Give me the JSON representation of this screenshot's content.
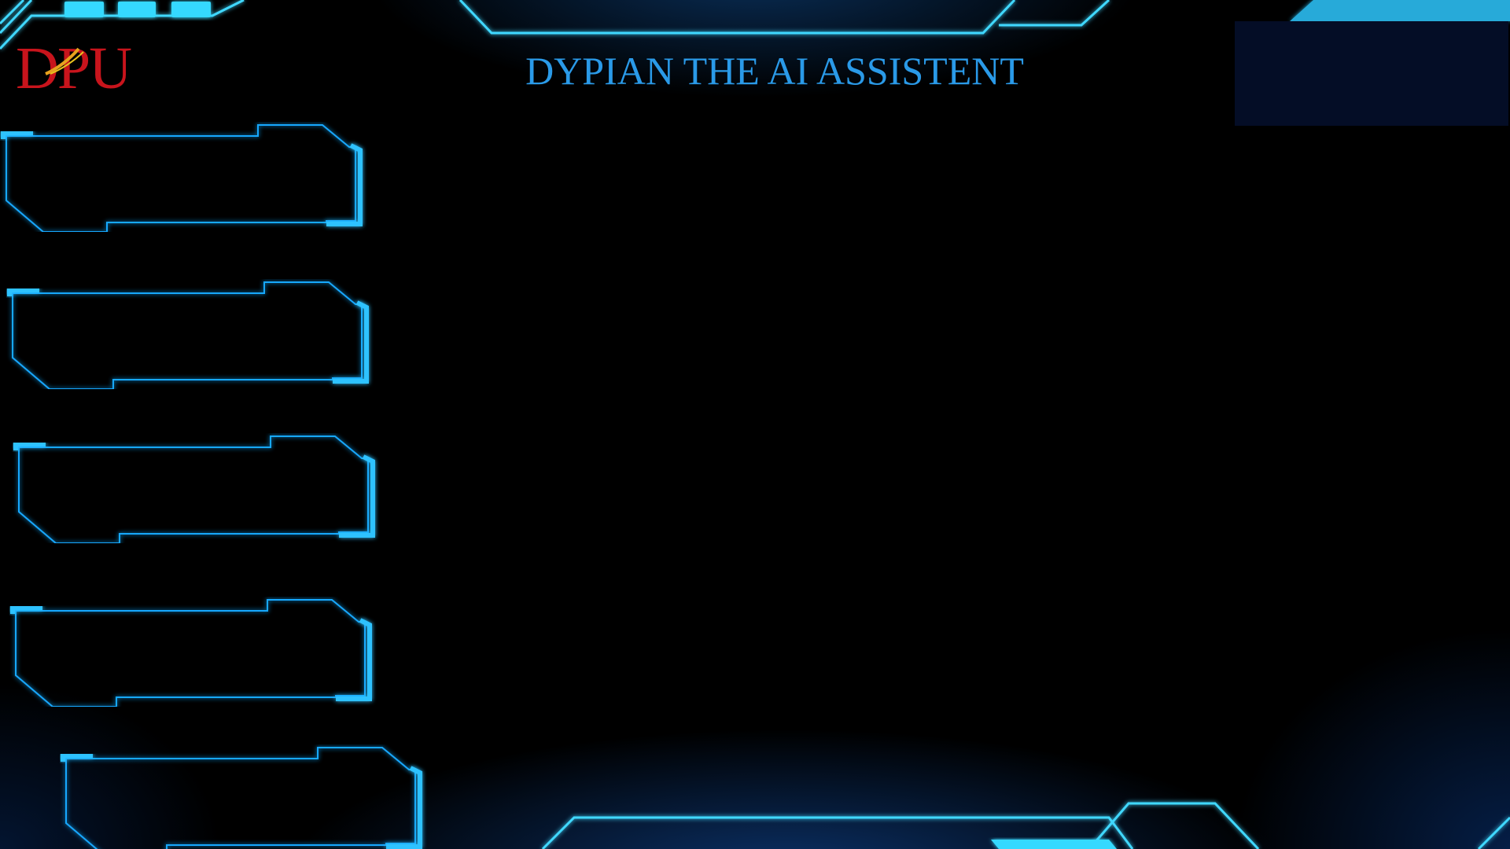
{
  "header": {
    "title": "DYPIAN THE AI ASSISTENT",
    "logo_text": "DPU"
  },
  "sidebar": {
    "items": [
      {
        "label": ""
      },
      {
        "label": ""
      },
      {
        "label": ""
      },
      {
        "label": ""
      },
      {
        "label": ""
      }
    ]
  },
  "colors": {
    "accent": "#19a8ff",
    "bright": "#3fd8ff",
    "title": "#2a9ae8",
    "logo": "#c8141c",
    "panel": "#040d26",
    "background": "#000000"
  }
}
